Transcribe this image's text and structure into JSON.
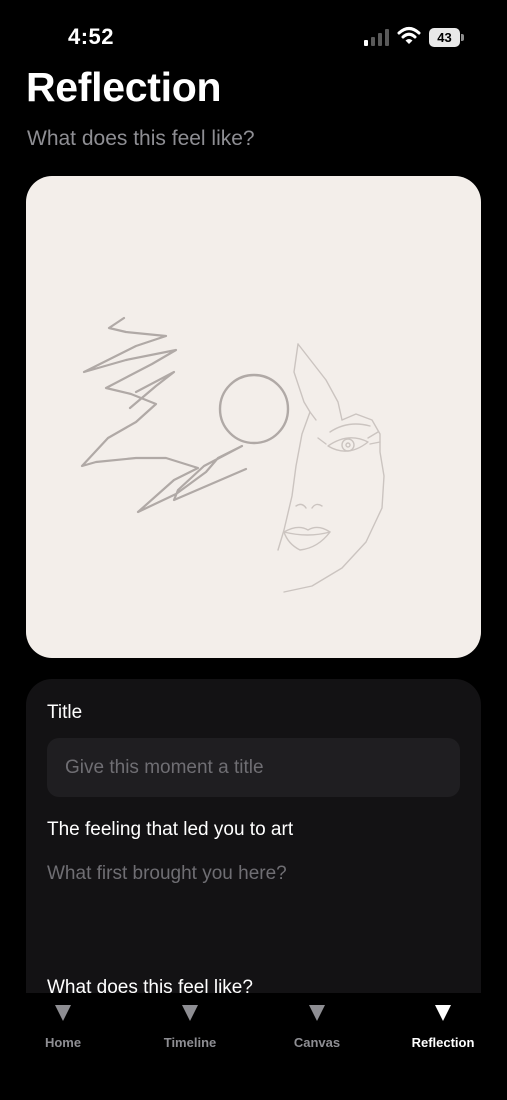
{
  "status_bar": {
    "time": "4:52",
    "battery": "43",
    "signal_icon": "cellular-signal-icon",
    "wifi_icon": "wifi-icon",
    "battery_icon": "battery-icon"
  },
  "header": {
    "title": "Reflection",
    "subtitle": "What does this feel like?"
  },
  "artwork": {
    "background_color": "#f3eeea",
    "stroke_color": "#b0a9a6"
  },
  "form": {
    "title_label": "Title",
    "title_value": "",
    "title_placeholder": "Give this moment a title",
    "feeling_label": "The feeling that led you to art",
    "feeling_value": "",
    "feeling_placeholder": "What first brought you here?",
    "reflection_label": "What does this feel like?"
  },
  "tab_bar": {
    "active_tab": "Reflection",
    "tabs": [
      {
        "label": "Home",
        "icon": "triangle-down-icon"
      },
      {
        "label": "Timeline",
        "icon": "triangle-down-icon"
      },
      {
        "label": "Canvas",
        "icon": "triangle-down-icon"
      },
      {
        "label": "Reflection",
        "icon": "triangle-down-icon"
      }
    ]
  },
  "colors": {
    "background": "#000000",
    "card": "#131214",
    "input": "#1f1e21",
    "muted_text": "#8e8e93",
    "placeholder": "#6f6e73"
  }
}
